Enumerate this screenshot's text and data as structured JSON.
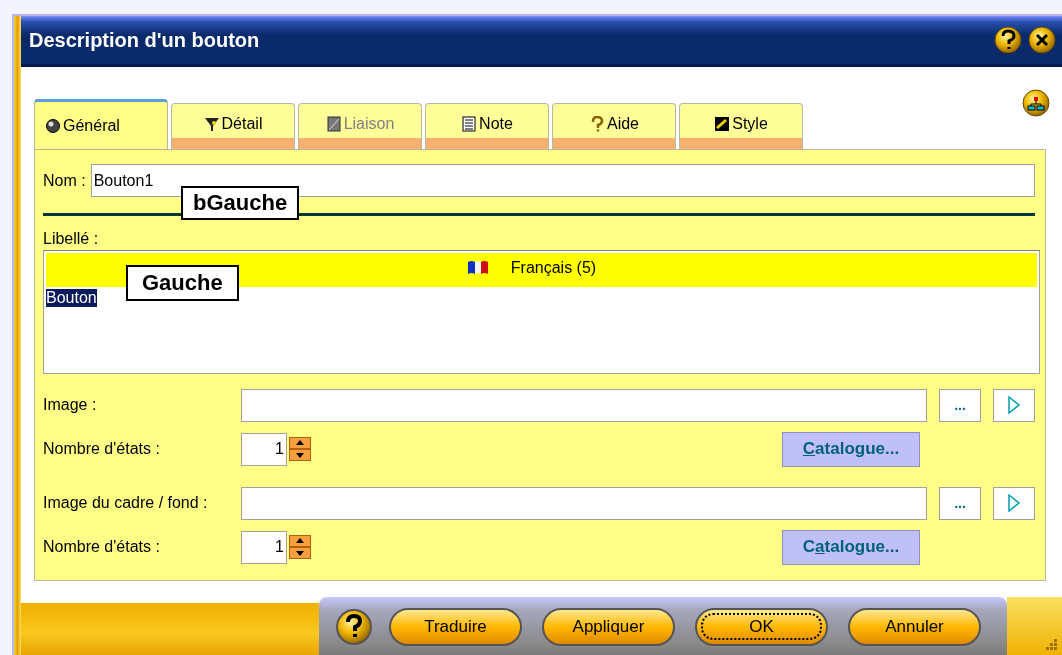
{
  "window": {
    "title": "Description d'un bouton",
    "title_buttons": [
      {
        "kind": "help"
      },
      {
        "kind": "close"
      }
    ]
  },
  "tabs": [
    {
      "label": "Général",
      "kind": "general",
      "selected": true,
      "disabled": false
    },
    {
      "label": "Détail",
      "kind": "detail",
      "selected": false,
      "disabled": false
    },
    {
      "label": "Liaison",
      "kind": "link",
      "selected": false,
      "disabled": true
    },
    {
      "label": "Note",
      "kind": "note",
      "selected": false,
      "disabled": false
    },
    {
      "label": "Aide",
      "kind": "help",
      "selected": false,
      "disabled": false
    },
    {
      "label": "Style",
      "kind": "style",
      "selected": false,
      "disabled": false
    }
  ],
  "name_field": {
    "label": "Nom :",
    "value": "Bouton1",
    "callout": "bGauche"
  },
  "caption": {
    "label": "Libellé :",
    "language": "Français (5)",
    "text": "Bouton",
    "text_selected": true,
    "callout": "Gauche"
  },
  "image_groups": [
    {
      "label": "Image :",
      "browse": "...",
      "states_label": "Nombre d'états :",
      "states": "1",
      "catalogue": {
        "accesskey": "C",
        "rest": "atalogue..."
      }
    },
    {
      "label": "Image du cadre / fond :",
      "browse": "...",
      "states_label": "Nombre d'états :",
      "states": "1",
      "catalogue": {
        "before": "C",
        "accesskey": "a",
        "rest": "talogue..."
      }
    }
  ],
  "footer_buttons": [
    {
      "kind": "help"
    },
    {
      "kind": "text",
      "label": "Traduire",
      "focused": false
    },
    {
      "kind": "text",
      "label": "Appliquer",
      "focused": false
    },
    {
      "kind": "text",
      "label": "OK",
      "focused": true
    },
    {
      "kind": "text",
      "label": "Annuler",
      "focused": false
    }
  ]
}
